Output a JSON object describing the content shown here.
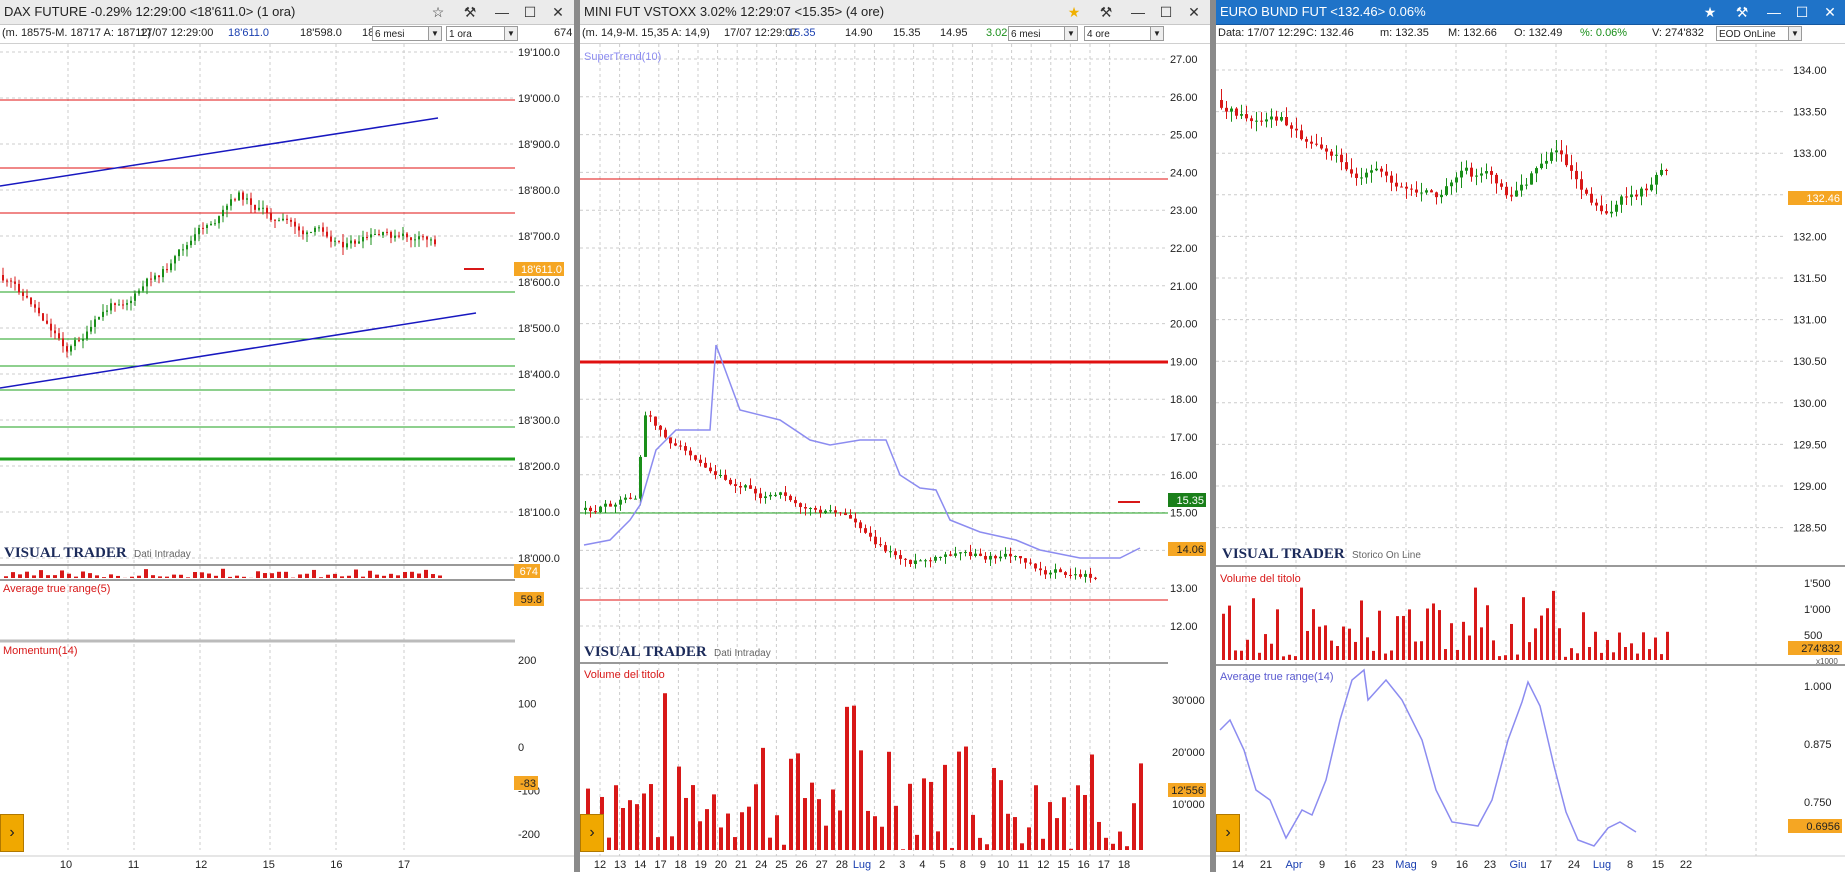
{
  "panels": [
    {
      "title": "DAX FUTURE -0.29% 12:29:00  <18'611.0> (1 ora)",
      "info": {
        "range": "(m. 18575-M. 18717 A: 18712)",
        "datetime": "17/07 12:29:00",
        "last": "18'611.0",
        "prev": "18'598.0",
        "extra": "18",
        "period": "6 mesi",
        "interval": "1 ora",
        "cut": "674"
      },
      "price_axis": [
        "19'100.0",
        "19'000.0",
        "18'900.0",
        "18'800.0",
        "18'700.0",
        "18'600.0",
        "18'500.0",
        "18'400.0",
        "18'300.0",
        "18'200.0",
        "18'100.0",
        "18'000.0"
      ],
      "price_tag": "18'611.0",
      "brand": "VISUAL TRADER",
      "brand_sub": "Dati Intraday",
      "volume_tag": "674",
      "indicators": [
        {
          "name": "Average true range(5)",
          "tag": "59.8"
        },
        {
          "name": "Momentum(14)",
          "tag": "-83",
          "axis": [
            "200",
            "100",
            "0",
            "-100",
            "-200"
          ]
        }
      ],
      "x_labels": [
        "10",
        "11",
        "12",
        "15",
        "16",
        "17"
      ]
    },
    {
      "title": "MINI FUT VSTOXX 3.02% 12:29:07  <15.35> (4 ore)",
      "info": {
        "range": "(m. 14,9-M. 15,35 A: 14,9)",
        "datetime": "17/07 12:29:07",
        "last": "15.35",
        "v1": "14.90",
        "v2": "15.35",
        "v3": "14.95",
        "chg": "3.02",
        "period": "6 mesi",
        "interval": "4 ore"
      },
      "indicator_label": "SuperTrend(10)",
      "price_axis": [
        "27.00",
        "26.00",
        "25.00",
        "24.00",
        "23.00",
        "22.00",
        "21.00",
        "20.00",
        "19.00",
        "18.00",
        "17.00",
        "16.00",
        "15.00",
        "14.00",
        "13.00",
        "12.00"
      ],
      "price_tag": "15.35",
      "supertrend_tag": "14.06",
      "brand": "VISUAL TRADER",
      "brand_sub": "Dati Intraday",
      "volume_label": "Volume del titolo",
      "volume_axis": [
        "30'000",
        "20'000",
        "10'000"
      ],
      "volume_tag": "12'556",
      "x_labels": [
        "12",
        "13",
        "14",
        "17",
        "18",
        "19",
        "20",
        "21",
        "24",
        "25",
        "26",
        "27",
        "28",
        "Lug",
        "2",
        "3",
        "4",
        "5",
        "8",
        "9",
        "10",
        "11",
        "12",
        "15",
        "16",
        "17",
        "18"
      ]
    },
    {
      "title": "EURO BUND FUT <132.46> 0.06%",
      "info": {
        "data": "Data: 17/07 12:29",
        "c": "C: 132.46",
        "m": "m: 132.35",
        "M": "M: 132.66",
        "o": "O: 132.49",
        "pct": "%: 0.06%",
        "v": "V: 274'832",
        "source": "EOD OnLine"
      },
      "price_axis": [
        "134.00",
        "133.50",
        "133.00",
        "132.50",
        "132.00",
        "131.50",
        "131.00",
        "130.50",
        "130.00",
        "129.50",
        "129.00",
        "128.50"
      ],
      "price_tag": "132.46",
      "brand": "VISUAL TRADER",
      "brand_sub": "Storico On Line",
      "volume_label": "Volume del titolo",
      "volume_axis": [
        "1'500",
        "1'000",
        "500"
      ],
      "volume_tag": "274'832",
      "volume_unit": "x1000",
      "atr_label": "Average true range(14)",
      "atr_axis": [
        "1.000",
        "0.875",
        "0.750"
      ],
      "atr_tag": "0.6956",
      "x_labels": [
        "14",
        "21",
        "Apr",
        "9",
        "16",
        "23",
        "Mag",
        "9",
        "16",
        "23",
        "Giu",
        "17",
        "24",
        "Lug",
        "8",
        "15",
        "22"
      ]
    }
  ],
  "colors": {
    "up": "#1a8f1a",
    "down": "#d81818",
    "hline_red": "#e01010",
    "hline_green": "#1ea01e",
    "trend": "#1818c0",
    "supertrend": "#8c8cf0",
    "tag": "#f5a623",
    "month": "#1a3fb0",
    "axis_text": "#222",
    "grid": "#cccccc"
  },
  "icons": [
    "star-icon",
    "pin-icon",
    "minimize-icon",
    "maximize-icon",
    "close-icon",
    "chevron-right-icon"
  ]
}
